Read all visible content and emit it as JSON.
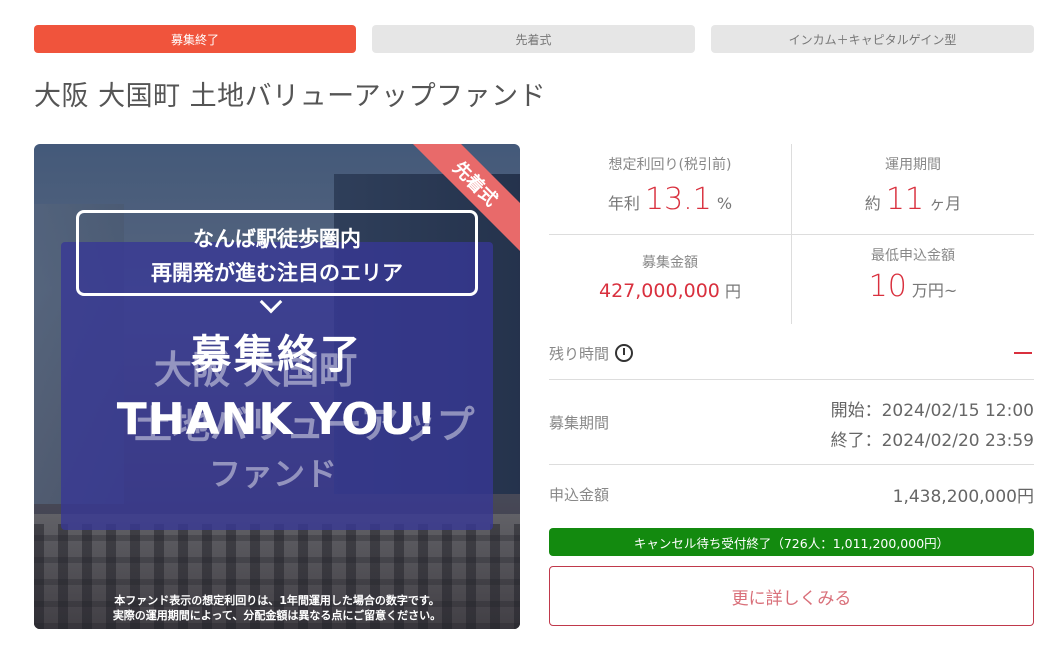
{
  "tags": {
    "status": "募集終了",
    "method": "先着式",
    "type": "インカム＋キャピタルゲイン型"
  },
  "fund_title": "大阪 大国町 土地バリューアップファンド",
  "image": {
    "ribbon": "先着式",
    "speech_line1": "なんば駅徒歩圏内",
    "speech_line2": "再開発が進む注目のエリア",
    "ghost_line1": "大阪 大国町",
    "ghost_line2": "土地バリューアップ",
    "ghost_line3": "ファンド",
    "closed_title": "募集終了",
    "closed_thanks": "THANK YOU!",
    "note_line1": "本ファンド表示の想定利回りは、1年間運用した場合の数字です。",
    "note_line2": "実際の運用期間によって、分配金額は異なる点にご留意ください。"
  },
  "metrics": {
    "yield_label": "想定利回り(税引前)",
    "yield_prefix": "年利",
    "yield_value": "13.1",
    "yield_unit": "%",
    "period_label": "運用期間",
    "period_prefix": "約",
    "period_value": "11",
    "period_unit": "ヶ月",
    "amount_label": "募集金額",
    "amount_value": "427,000,000",
    "amount_unit": "円",
    "min_label": "最低申込金額",
    "min_value": "10",
    "min_unit": "万円~"
  },
  "remaining": {
    "label": "残り時間",
    "value": "—"
  },
  "period": {
    "label": "募集期間",
    "start": "開始：2024/02/15 12:00",
    "end": "終了：2024/02/20 23:59"
  },
  "applied": {
    "label": "申込金額",
    "value": "1,438,200,000円"
  },
  "status_bar": "キャンセル待ち受付終了（726人：1,011,200,000円）",
  "detail_button": "更に詳しくみる",
  "colors": {
    "accent": "#f0543c",
    "red_text": "#d9303e",
    "status_green": "#138a0f"
  }
}
